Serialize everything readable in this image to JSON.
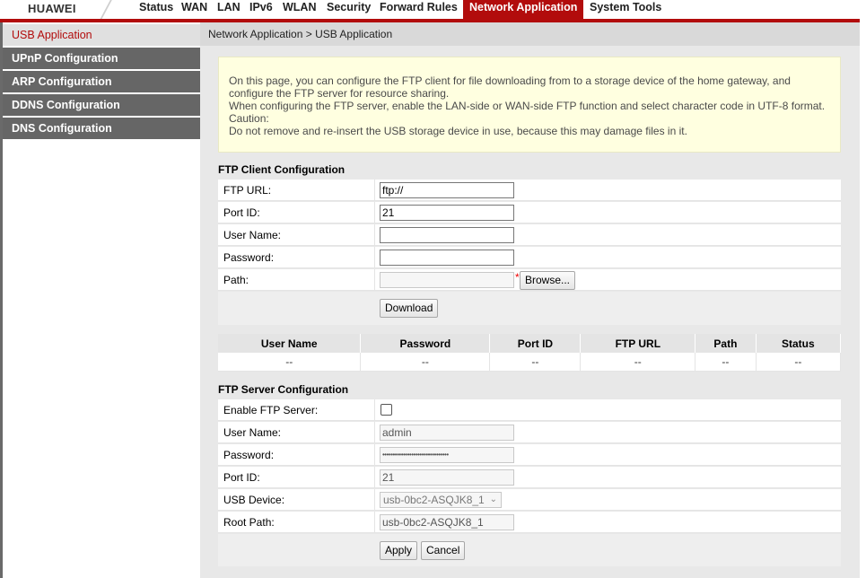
{
  "brand": {
    "logo_text": "HUAWEI"
  },
  "colors": {
    "accent": "#b20c0c",
    "sidebar_bg": "#666666",
    "notice_bg": "#ffffe0"
  },
  "top_nav": [
    {
      "label": "Status",
      "active": false
    },
    {
      "label": "WAN",
      "active": false
    },
    {
      "label": "LAN",
      "active": false
    },
    {
      "label": "IPv6",
      "active": false
    },
    {
      "label": "WLAN",
      "active": false
    },
    {
      "label": "Security",
      "active": false
    },
    {
      "label": "Forward Rules",
      "active": false
    },
    {
      "label": "Network Application",
      "active": true
    },
    {
      "label": "System Tools",
      "active": false
    }
  ],
  "sidebar": {
    "items": [
      {
        "label": "USB Application",
        "active": true
      },
      {
        "label": "UPnP Configuration",
        "active": false
      },
      {
        "label": "ARP Configuration",
        "active": false
      },
      {
        "label": "DDNS Configuration",
        "active": false
      },
      {
        "label": "DNS Configuration",
        "active": false
      }
    ]
  },
  "breadcrumb": "Network Application > USB Application",
  "notice": {
    "line1": "On this page, you can configure the FTP client for file downloading from to a storage device of the home gateway, and",
    "line2": "configure the FTP server for resource sharing.",
    "line3": "When configuring the FTP server, enable the LAN-side or WAN-side FTP function and select character code in UTF-8 format.",
    "line4": "Caution:",
    "line5": "Do not remove and re-insert the USB storage device in use, because this may damage files in it."
  },
  "ftp_client": {
    "title": "FTP Client Configuration",
    "url_label": "FTP URL:",
    "url_value": "ftp://",
    "port_label": "Port ID:",
    "port_value": "21",
    "user_label": "User Name:",
    "user_value": "",
    "password_label": "Password:",
    "password_value": "",
    "path_label": "Path:",
    "path_value": "",
    "required_mark": "*",
    "browse_label": "Browse...",
    "download_label": "Download"
  },
  "client_table": {
    "headers": [
      "User Name",
      "Password",
      "Port ID",
      "FTP URL",
      "Path",
      "Status"
    ],
    "row": [
      "--",
      "--",
      "--",
      "--",
      "--",
      "--"
    ]
  },
  "ftp_server": {
    "title": "FTP Server Configuration",
    "enable_label": "Enable FTP Server:",
    "enabled": false,
    "user_label": "User Name:",
    "user_value": "admin",
    "password_label": "Password:",
    "password_value": "••••••••••••••••••••••••••••••••",
    "port_label": "Port ID:",
    "port_value": "21",
    "usb_label": "USB Device:",
    "usb_value": "usb-0bc2-ASQJK8_1",
    "root_label": "Root Path:",
    "root_value": "usb-0bc2-ASQJK8_1",
    "apply_label": "Apply",
    "cancel_label": "Cancel"
  }
}
